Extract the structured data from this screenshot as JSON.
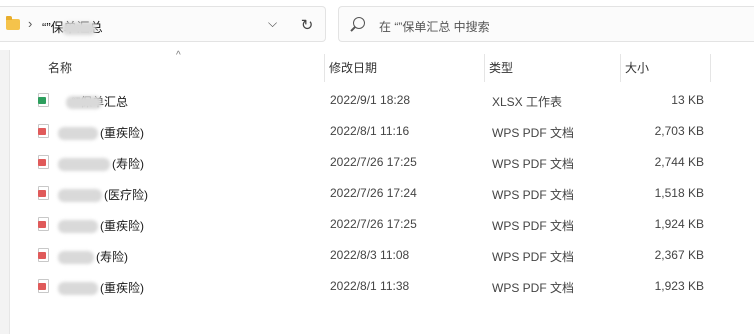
{
  "address_bar": {
    "separator": "›",
    "breadcrumb": "“”保单汇总",
    "dropdown_glyph": "⌵",
    "refresh_glyph": "↻"
  },
  "search": {
    "placeholder": "在 “”保单汇总 中搜索"
  },
  "columns": {
    "name": "名称",
    "modified": "修改日期",
    "type": "类型",
    "size": "大小",
    "sort_glyph": "^"
  },
  "files": [
    {
      "name": "“”保单汇总",
      "date": "2022/9/1 18:28",
      "type": "XLSX 工作表",
      "size": "13 KB",
      "kind": "xlsx",
      "color": "#2e9f5e"
    },
    {
      "name": "(重疾险)",
      "date": "2022/8/1 11:16",
      "type": "WPS PDF 文档",
      "size": "2,703 KB",
      "kind": "pdf",
      "color": "#e05a5a"
    },
    {
      "name": "(寿险)",
      "date": "2022/7/26 17:25",
      "type": "WPS PDF 文档",
      "size": "2,744 KB",
      "kind": "pdf",
      "color": "#e05a5a"
    },
    {
      "name": "(医疗险)",
      "date": "2022/7/26 17:24",
      "type": "WPS PDF 文档",
      "size": "1,518 KB",
      "kind": "pdf",
      "color": "#e05a5a"
    },
    {
      "name": "(重疾险)",
      "date": "2022/7/26 17:25",
      "type": "WPS PDF 文档",
      "size": "1,924 KB",
      "kind": "pdf",
      "color": "#e05a5a"
    },
    {
      "name": "(寿险)",
      "date": "2022/8/3 11:08",
      "type": "WPS PDF 文档",
      "size": "2,367 KB",
      "kind": "pdf",
      "color": "#e05a5a"
    },
    {
      "name": "(重疾险)",
      "date": "2022/8/1 11:38",
      "type": "WPS PDF 文档",
      "size": "1,923 KB",
      "kind": "pdf",
      "color": "#e05a5a"
    }
  ]
}
